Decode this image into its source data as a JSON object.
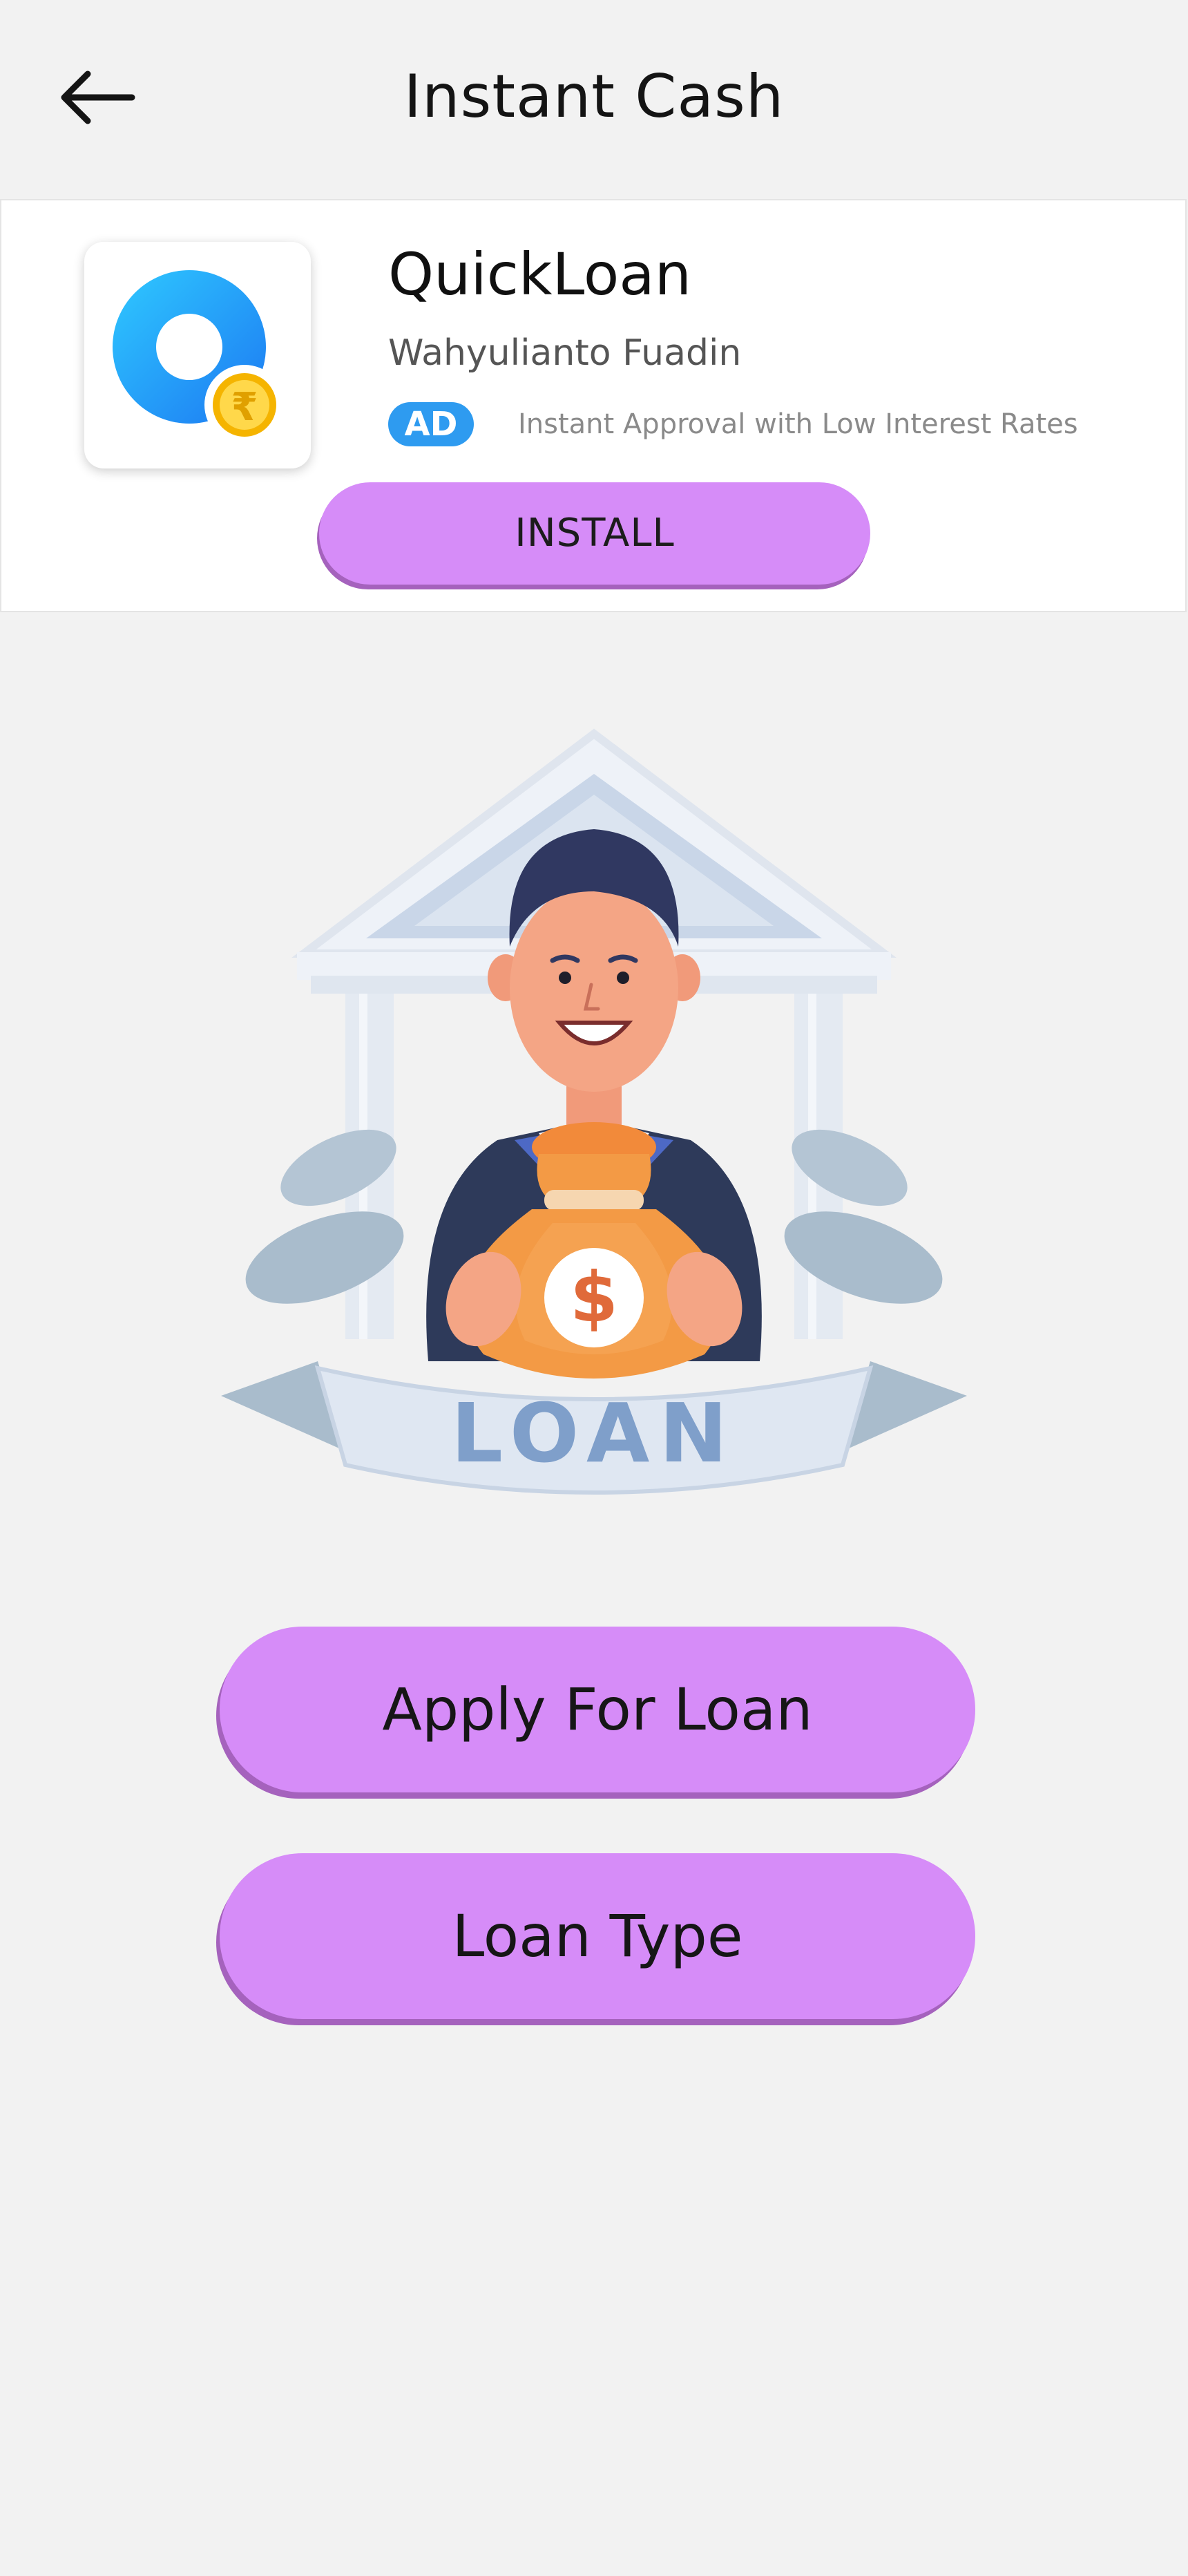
{
  "header": {
    "title": "Instant Cash"
  },
  "ad": {
    "app_name": "QuickLoan",
    "developer": "Wahyulianto Fuadin",
    "badge": "AD",
    "tagline": "Instant Approval with Low Interest Rates",
    "install_label": "INSTALL",
    "icon": "quickloan-app-icon",
    "coin_symbol": "₹"
  },
  "illustration": {
    "banner_text": "LOAN",
    "bag_symbol": "$"
  },
  "actions": {
    "apply_label": "Apply For Loan",
    "type_label": "Loan Type"
  },
  "colors": {
    "background": "#f2f2f2",
    "button": "#d68cf8",
    "button_shadow": "#a562bd",
    "ad_badge": "#2e9bf0"
  }
}
